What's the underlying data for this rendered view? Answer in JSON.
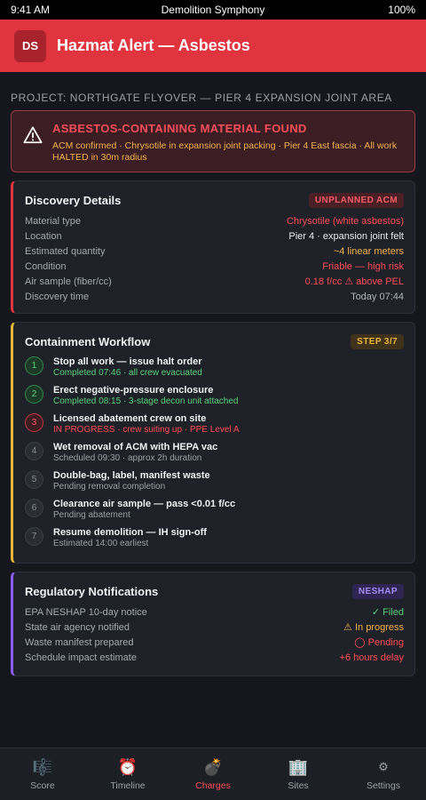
{
  "status": {
    "time": "9:41 AM",
    "app": "Demolition Symphony",
    "battery": "100%"
  },
  "header": {
    "avatar": "DS",
    "title": "Hazmat Alert — Asbestos"
  },
  "project": "PROJECT: NORTHGATE FLYOVER — PIER 4 EXPANSION JOINT AREA",
  "alert": {
    "title": "ASBESTOS-CONTAINING MATERIAL FOUND",
    "text": "ACM confirmed · Chrysotile in expansion joint packing · Pier 4 East fascia · All work HALTED in 30m radius"
  },
  "discovery": {
    "title": "Discovery Details",
    "badge": "UNPLANNED ACM",
    "rows": [
      {
        "k": "Material type",
        "v": "Chrysotile (white asbestos)",
        "color": "red"
      },
      {
        "k": "Location",
        "v": "Pier 4 · expansion joint felt",
        "color": "white"
      },
      {
        "k": "Estimated quantity",
        "v": "~4 linear meters",
        "color": "amber"
      },
      {
        "k": "Condition",
        "v": "Friable — high risk",
        "color": "red"
      },
      {
        "k": "Air sample (fiber/cc)",
        "v": "0.18 f/cc ⚠ above PEL",
        "color": "red"
      },
      {
        "k": "Discovery time",
        "v": "Today 07:44",
        "color": "gray"
      }
    ]
  },
  "workflow": {
    "title": "Containment Workflow",
    "badge": "STEP 3/7",
    "steps": [
      {
        "n": "1",
        "title": "Stop all work — issue halt order",
        "sub": "Completed 07:46 · all crew evacuated",
        "state": "done"
      },
      {
        "n": "2",
        "title": "Erect negative-pressure enclosure",
        "sub": "Completed 08:15 · 3-stage decon unit attached",
        "state": "done"
      },
      {
        "n": "3",
        "title": "Licensed abatement crew on site",
        "sub": "IN PROGRESS · crew suiting up · PPE Level A",
        "state": "active"
      },
      {
        "n": "4",
        "title": "Wet removal of ACM with HEPA vac",
        "sub": "Scheduled 09:30 · approx 2h duration",
        "state": "pending"
      },
      {
        "n": "5",
        "title": "Double-bag, label, manifest waste",
        "sub": "Pending removal completion",
        "state": "pending"
      },
      {
        "n": "6",
        "title": "Clearance air sample — pass <0.01 f/cc",
        "sub": "Pending abatement",
        "state": "pending"
      },
      {
        "n": "7",
        "title": "Resume demolition — IH sign-off",
        "sub": "Estimated 14:00 earliest",
        "state": "pending"
      }
    ]
  },
  "regulatory": {
    "title": "Regulatory Notifications",
    "badge": "NESHAP",
    "rows": [
      {
        "k": "EPA NESHAP 10-day notice",
        "v": "✓ Filed",
        "color": "green"
      },
      {
        "k": "State air agency notified",
        "v": "⚠ In progress",
        "color": "amber"
      },
      {
        "k": "Waste manifest prepared",
        "v": "◯ Pending",
        "color": "red"
      },
      {
        "k": "Schedule impact estimate",
        "v": "+6 hours delay",
        "color": "red"
      }
    ]
  },
  "nav": [
    {
      "label": "Score",
      "icon": "🎼",
      "icon_name": "score-icon",
      "active": false
    },
    {
      "label": "Timeline",
      "icon": "⏰",
      "icon_name": "alarm-clock-icon",
      "active": false
    },
    {
      "label": "Charges",
      "icon": "💣",
      "icon_name": "bomb-icon",
      "active": true
    },
    {
      "label": "Sites",
      "icon": "🏢",
      "icon_name": "building-icon",
      "active": false
    },
    {
      "label": "Settings",
      "icon": "⚙",
      "icon_name": "gear-icon",
      "active": false
    }
  ]
}
